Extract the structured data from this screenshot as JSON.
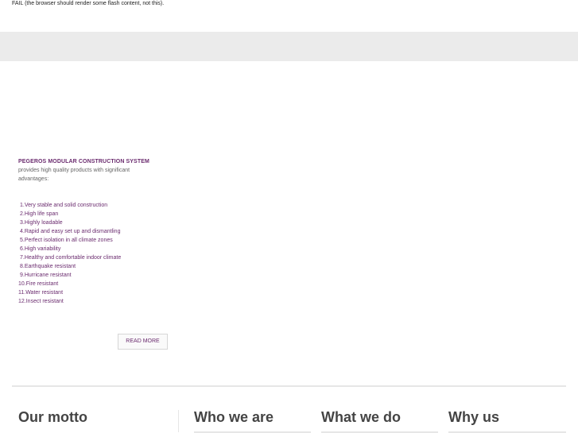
{
  "flash_fallback": "FAIL (the browser should render some flash content, not this).",
  "intro": {
    "title": "PEGEROS MODULAR CONSTRUCTION SYSTEM",
    "description": "provides high quality products with significant advantages:"
  },
  "advantages": [
    "1.Very stable and solid construction",
    "2.High life span",
    "3.Highly loadable",
    "4.Rapid and easy set up and dismantling",
    "5.Perfect isolation in all climate zones",
    "6.High variability",
    "7.Healthy and comfortable indoor climate",
    "8.Earthquake resistant",
    "9.Hurricane resistant",
    "10.Fire resistant",
    "11.Water resistant",
    "12.Insect resistant"
  ],
  "read_more_label": "READ MORE",
  "footer": {
    "motto": "Our motto",
    "who": "Who we are",
    "what": "What we do",
    "why": "Why us"
  },
  "colors": {
    "accent": "#6b2c6f",
    "band": "#ebebeb"
  }
}
